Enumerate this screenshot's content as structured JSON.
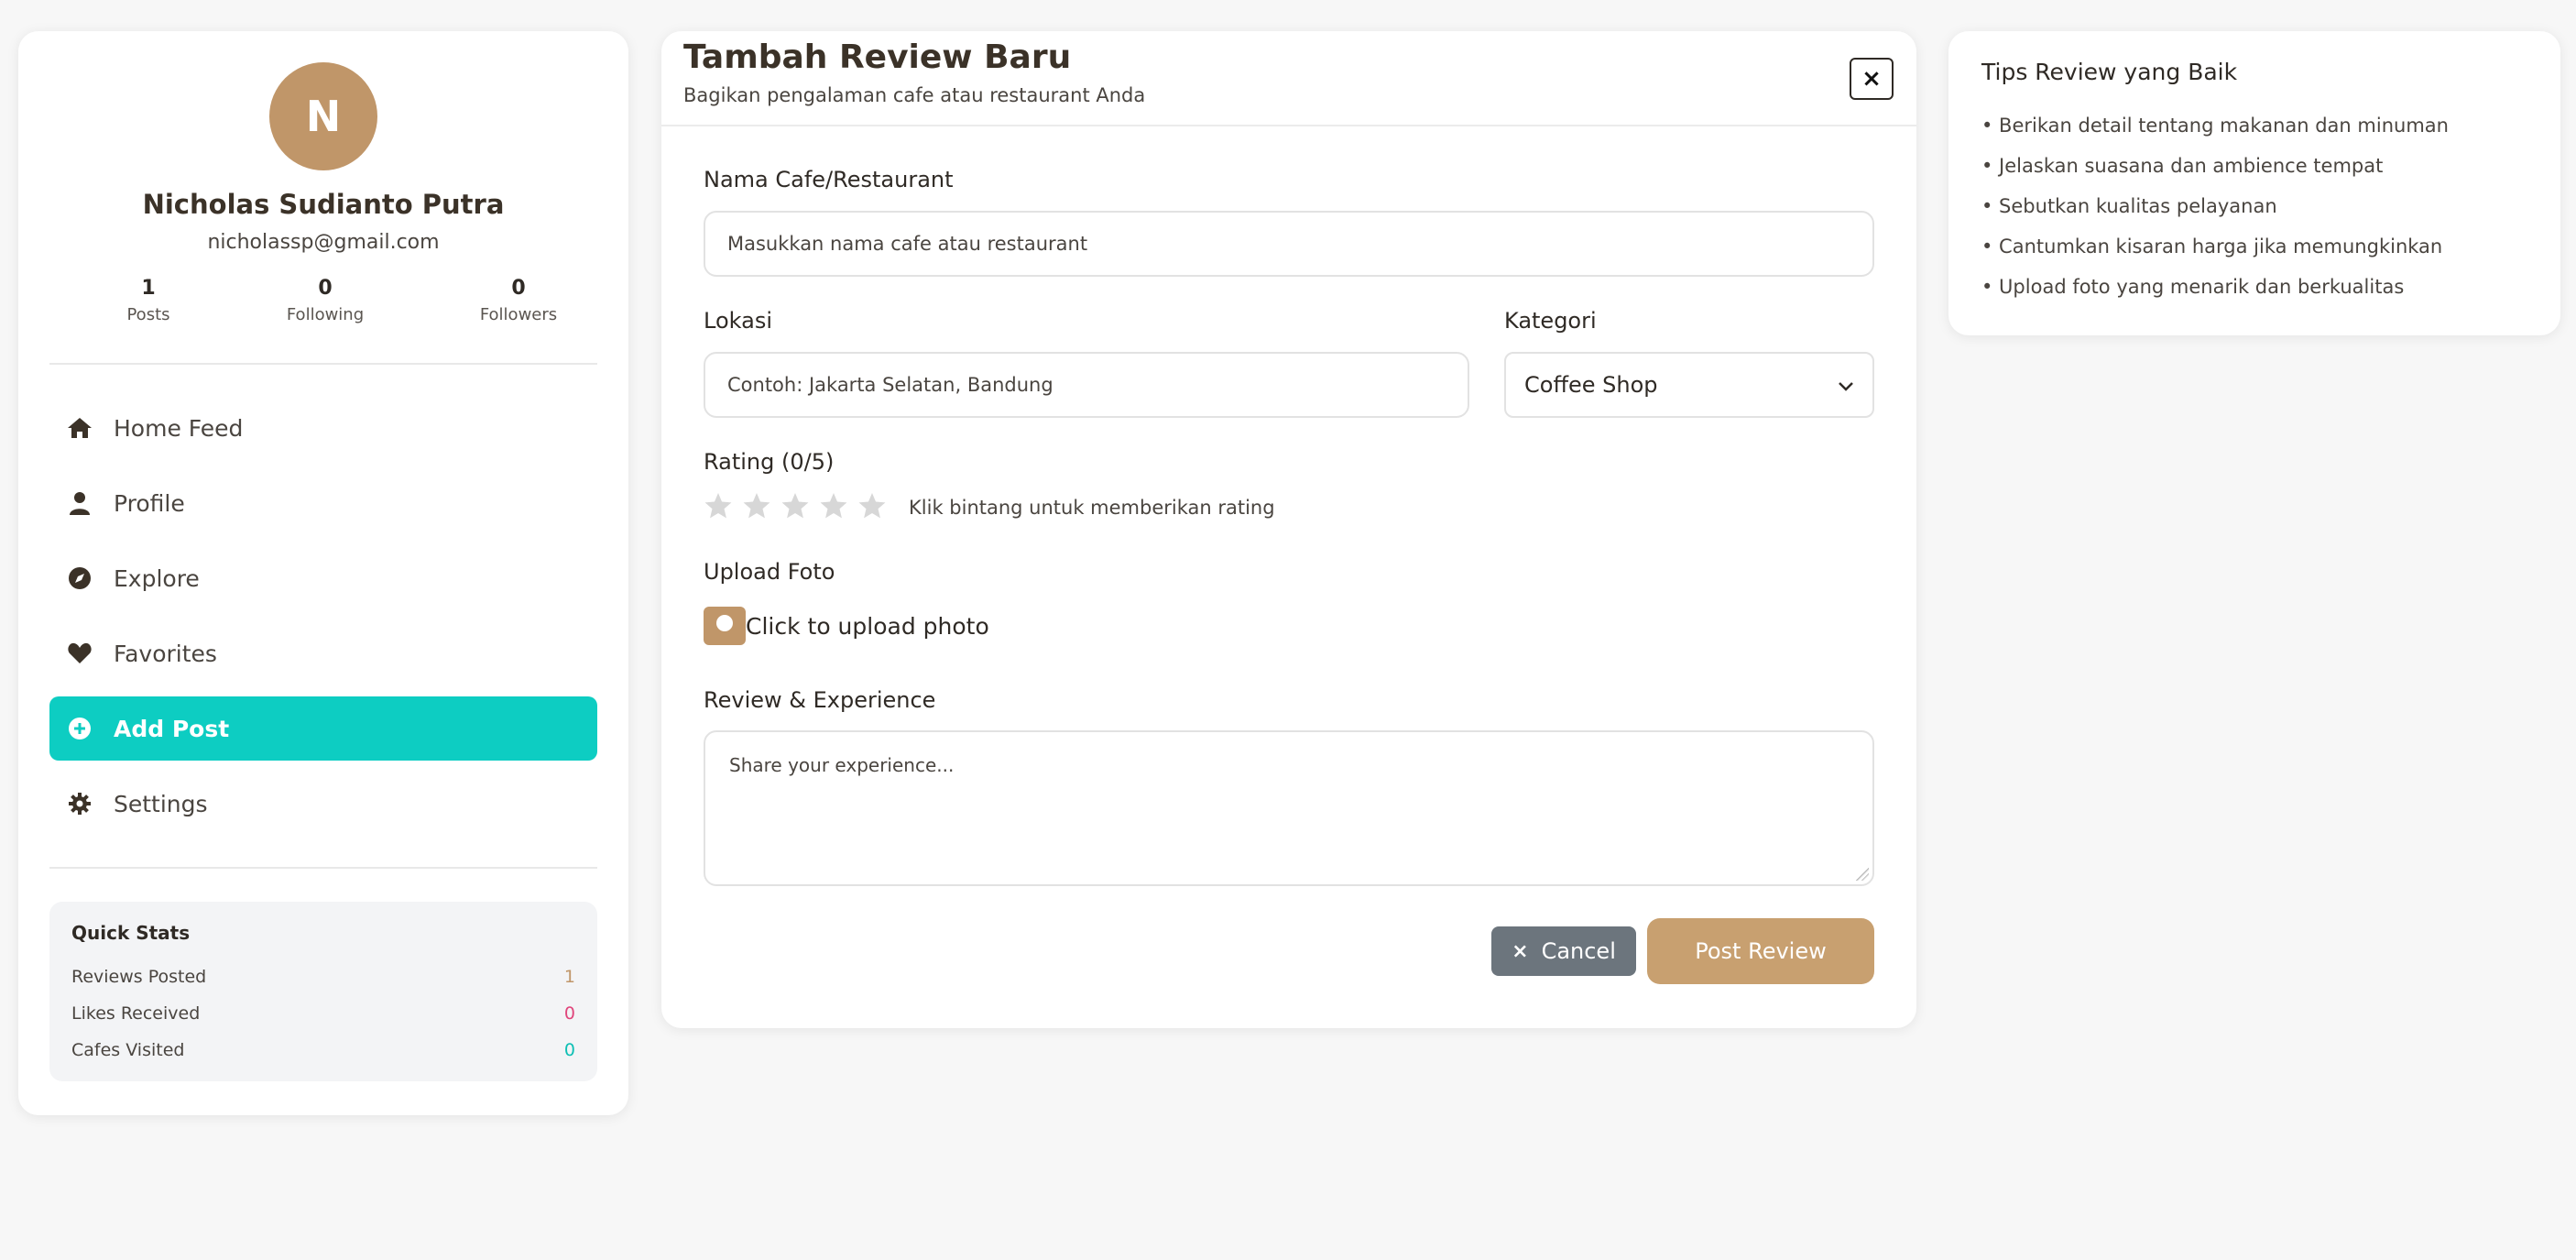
{
  "profile": {
    "avatar_initial": "N",
    "name": "Nicholas Sudianto Putra",
    "email": "nicholassp@gmail.com",
    "stats": [
      {
        "value": "1",
        "label": "Posts"
      },
      {
        "value": "0",
        "label": "Following"
      },
      {
        "value": "0",
        "label": "Followers"
      }
    ]
  },
  "nav": {
    "items": [
      {
        "label": "Home Feed",
        "icon": "home-icon"
      },
      {
        "label": "Profile",
        "icon": "user-icon"
      },
      {
        "label": "Explore",
        "icon": "compass-icon"
      },
      {
        "label": "Favorites",
        "icon": "heart-icon"
      },
      {
        "label": "Add Post",
        "icon": "plus-circle-icon",
        "active": true
      },
      {
        "label": "Settings",
        "icon": "gear-icon"
      }
    ]
  },
  "quick_stats": {
    "title": "Quick Stats",
    "rows": [
      {
        "label": "Reviews Posted",
        "value": "1",
        "color": "#c09669"
      },
      {
        "label": "Likes Received",
        "value": "0",
        "color": "#e0457b"
      },
      {
        "label": "Cafes Visited",
        "value": "0",
        "color": "#0dbfb4"
      }
    ]
  },
  "form": {
    "title": "Tambah Review Baru",
    "subtitle": "Bagikan pengalaman cafe atau restaurant Anda",
    "close_label": "×",
    "name_label": "Nama Cafe/Restaurant",
    "name_placeholder": "Masukkan nama cafe atau restaurant",
    "location_label": "Lokasi",
    "location_placeholder": "Contoh: Jakarta Selatan, Bandung",
    "category_label": "Kategori",
    "category_value": "Coffee Shop",
    "rating_label": "Rating (0/5)",
    "rating_value": 0,
    "rating_max": 5,
    "rating_hint": "Klik bintang untuk memberikan rating",
    "upload_label": "Upload Foto",
    "upload_text": "Click to upload photo",
    "review_label": "Review & Experience",
    "review_placeholder": "Share your experience...",
    "cancel_label": "Cancel",
    "cancel_icon": "×",
    "post_label": "Post Review"
  },
  "tips": {
    "title": "Tips Review yang Baik",
    "items": [
      "• Berikan detail tentang makanan dan minuman",
      "• Jelaskan suasana dan ambience tempat",
      "• Sebutkan kualitas pelayanan",
      "• Cantumkan kisaran harga jika memungkinkan",
      "• Upload foto yang menarik dan berkualitas"
    ]
  },
  "colors": {
    "accent": "#0dcdc2",
    "brand": "#c09669",
    "cancel": "#6c757d"
  }
}
